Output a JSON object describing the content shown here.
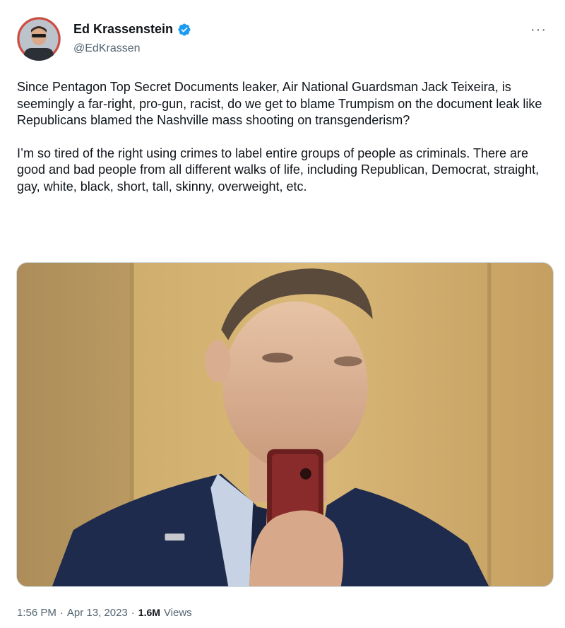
{
  "author": {
    "display_name": "Ed Krassenstein",
    "handle": "@EdKrassen",
    "avatar_icon": "user-avatar",
    "verified_icon": "verified-badge-icon",
    "verified_color": "#1d9bf0"
  },
  "more_icon": "more-options-icon",
  "tweet": {
    "paragraphs": [
      "Since Pentagon Top Secret Documents leaker, Air National Guardsman Jack Teixeira, is seemingly a far-right, pro-gun, racist, do we get to blame Trumpism on the document leak like Republicans blamed the Nashville mass shooting on transgenderism?",
      "I’m so tired of the right using crimes to label entire groups of people as criminals. There are good and bad people from all different walks of life, including Republican, Democrat, straight, gay, white, black, short, tall, skinny, overweight, etc."
    ]
  },
  "media": {
    "type": "photo"
  },
  "meta": {
    "time": "1:56 PM",
    "date": "Apr 13, 2023",
    "separator": "·",
    "views_count": "1.6M",
    "views_label": "Views"
  }
}
